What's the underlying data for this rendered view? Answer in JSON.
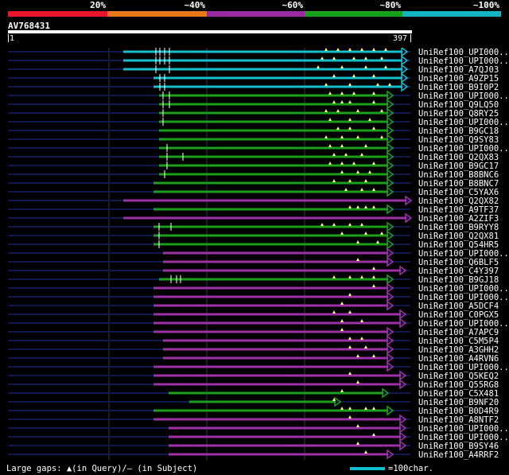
{
  "legend": {
    "items": [
      {
        "label": "",
        "color": "#e8142c"
      },
      {
        "label": "20%",
        "color": "#e87a1c"
      },
      {
        "label": "~40%",
        "color": "#9a2aa0"
      },
      {
        "label": "~60%",
        "color": "#1aa01a"
      },
      {
        "label": "~80%",
        "color": "#14b4c0"
      },
      {
        "label": "~100%",
        "color": ""
      }
    ]
  },
  "query": {
    "title": "AV768431",
    "start": "1",
    "end": "397"
  },
  "colors": {
    "cyan": "#14c0cc",
    "green": "#1ca01c",
    "purple": "#a030a8",
    "gap": "#ffff80",
    "guide": "#101850"
  },
  "hits": [
    {
      "label": "UniRef100_UPI000...",
      "color": "cyan"
    },
    {
      "label": "UniRef100_UPI000...",
      "color": "cyan"
    },
    {
      "label": "UniRef100_A7QJ03",
      "color": "cyan"
    },
    {
      "label": "UniRef100_A9ZP15",
      "color": "cyan"
    },
    {
      "label": "UniRef100_B9I0P2",
      "color": "cyan"
    },
    {
      "label": "UniRef100_UPI000...",
      "color": "green"
    },
    {
      "label": "UniRef100_Q9LQ50",
      "color": "green"
    },
    {
      "label": "UniRef100_Q8RY25",
      "color": "green"
    },
    {
      "label": "UniRef100_UPI000...",
      "color": "green"
    },
    {
      "label": "UniRef100_B9GC18",
      "color": "green"
    },
    {
      "label": "UniRef100_Q9SY83",
      "color": "green"
    },
    {
      "label": "UniRef100_UPI000...",
      "color": "green"
    },
    {
      "label": "UniRef100_Q2QX83",
      "color": "green"
    },
    {
      "label": "UniRef100_B9GC17",
      "color": "green"
    },
    {
      "label": "UniRef100_B8BNC6",
      "color": "green"
    },
    {
      "label": "UniRef100_B8BNC7",
      "color": "green"
    },
    {
      "label": "UniRef100_C5YAX6",
      "color": "green"
    },
    {
      "label": "UniRef100_Q2QX82",
      "color": "purple"
    },
    {
      "label": "UniRef100_A9TF37",
      "color": "green"
    },
    {
      "label": "UniRef100_A2ZIF3",
      "color": "purple"
    },
    {
      "label": "UniRef100_B9RYY8",
      "color": "green"
    },
    {
      "label": "UniRef100_Q2QX81",
      "color": "green"
    },
    {
      "label": "UniRef100_Q54HR5",
      "color": "green"
    },
    {
      "label": "UniRef100_UPI000...",
      "color": "purple"
    },
    {
      "label": "UniRef100_Q6BLF5",
      "color": "purple"
    },
    {
      "label": "UniRef100_C4Y397",
      "color": "purple"
    },
    {
      "label": "UniRef100_B9GJ18",
      "color": "green"
    },
    {
      "label": "UniRef100_UPI000...",
      "color": "purple"
    },
    {
      "label": "UniRef100_UPI000...",
      "color": "purple"
    },
    {
      "label": "UniRef100_A5DCF4",
      "color": "purple"
    },
    {
      "label": "UniRef100_C0PGX5",
      "color": "purple"
    },
    {
      "label": "UniRef100_UPI000...",
      "color": "purple"
    },
    {
      "label": "UniRef100_A7APC9",
      "color": "purple"
    },
    {
      "label": "UniRef100_C5M5P4",
      "color": "purple"
    },
    {
      "label": "UniRef100_A3GHH2",
      "color": "purple"
    },
    {
      "label": "UniRef100_A4RVN6",
      "color": "purple"
    },
    {
      "label": "UniRef100_UPI000...",
      "color": "purple"
    },
    {
      "label": "UniRef100_Q5KEQ2",
      "color": "purple"
    },
    {
      "label": "UniRef100_Q55RG8",
      "color": "purple"
    },
    {
      "label": "UniRef100_C5X481",
      "color": "green"
    },
    {
      "label": "UniRef100_B9NF20",
      "color": "green"
    },
    {
      "label": "UniRef100_B0D4R9",
      "color": "green"
    },
    {
      "label": "UniRef100_A8NTF2",
      "color": "purple"
    },
    {
      "label": "UniRef100_UPI000...",
      "color": "purple"
    },
    {
      "label": "UniRef100_UPI000...",
      "color": "purple"
    },
    {
      "label": "UniRef100_B9SY46",
      "color": "purple"
    },
    {
      "label": "UniRef100_A4RRF2",
      "color": "purple"
    }
  ],
  "footer": {
    "large_gaps": "Large gaps: ▲(in Query)/– (in Subject)",
    "scale_label": "=100char."
  }
}
